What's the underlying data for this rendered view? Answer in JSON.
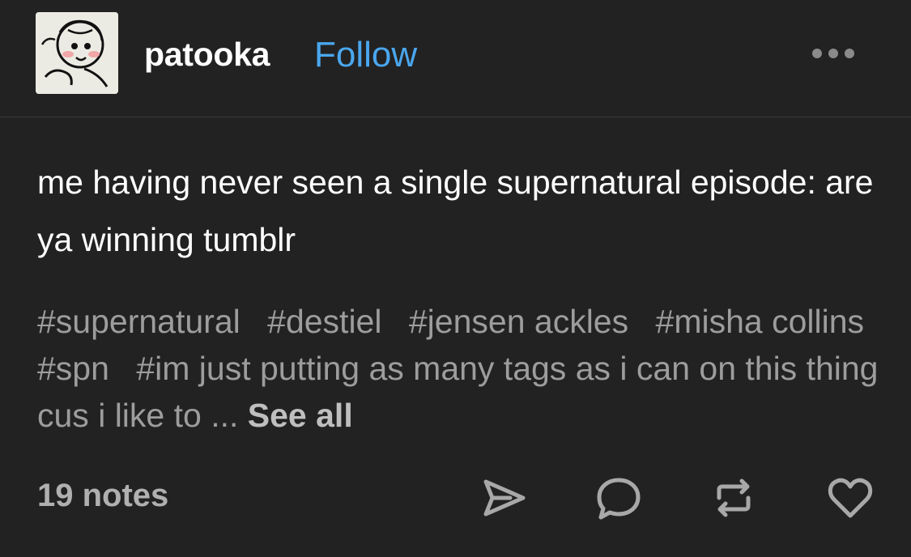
{
  "post": {
    "username": "patooka",
    "follow_label": "Follow",
    "more_icon": "more-horizontal-icon",
    "body": "me having never seen a single supernatural episode: are ya winning tumblr",
    "tags": [
      "#supernatural",
      "#destiel",
      "#jensen ackles",
      "#misha collins",
      "#spn",
      "#im just putting as many tags as i can on this thing cus i like to ..."
    ],
    "see_all_label": "See all",
    "notes": "19 notes",
    "actions": {
      "share_icon": "send-icon",
      "reply_icon": "comment-icon",
      "reblog_icon": "reblog-icon",
      "like_icon": "heart-icon"
    }
  },
  "colors": {
    "background": "#222222",
    "follow": "#4aa7ee",
    "tag_text": "#9d9d9d",
    "icon": "#a8a8a8"
  }
}
